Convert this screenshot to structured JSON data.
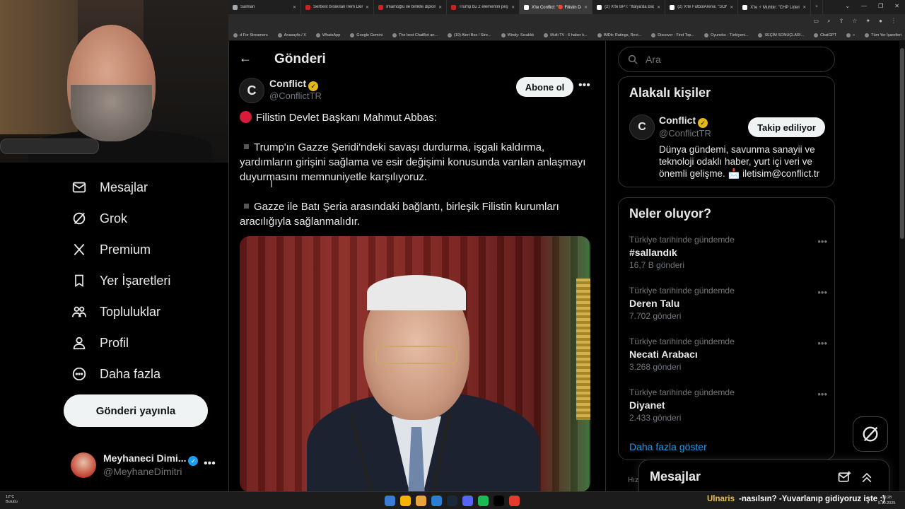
{
  "browser": {
    "tabs": [
      {
        "label": "Salman",
        "color": "#aaaaaa",
        "active": false
      },
      {
        "label": "Serbest bırakılan İrem Derici,",
        "color": "#cc2222",
        "active": false
      },
      {
        "label": "İmamoğlu ile birlikte diploma",
        "color": "#cc2222",
        "active": false
      },
      {
        "label": "Trump bu 2 elementin peşinde",
        "color": "#cc2222",
        "active": false
      },
      {
        "label": "X'te Conflict: \"🔴 Filistin Devl",
        "color": "#ffffff",
        "active": true
      },
      {
        "label": "(2) X'te BPT: \"İtalya'da Başbak",
        "color": "#ffffff",
        "active": false
      },
      {
        "label": "(2) X'te FutbolArena: \"SON D",
        "color": "#ffffff",
        "active": false
      },
      {
        "label": "X'te ⚡ Muhbir: \"CHP Lideri Ö",
        "color": "#ffffff",
        "active": false
      }
    ],
    "new_tab": "+",
    "window_controls": [
      "⌄",
      "—",
      "❐",
      "✕"
    ],
    "bookmarks": [
      "d For Streamers",
      "Anasayfa / X",
      "WhatsApp",
      "Google Gemini",
      "The best ChatBot an...",
      "(19) Alert Box / Stre...",
      "Windy: Sıcaklık",
      "Multi TV - 6 haber k...",
      "IMDb: Ratings, Revi...",
      "Discover - Find Top...",
      "Oyuneks - Türkiyeni...",
      "SEÇİM SONUÇLARI...",
      "ChatGPT",
      "»",
      "Tüm Yer İşaretleri"
    ]
  },
  "sidebar": {
    "items": [
      {
        "label": "Mesajlar",
        "icon": "mail-icon",
        "name": "sidebar-item-messages"
      },
      {
        "label": "Grok",
        "icon": "grok-icon",
        "name": "sidebar-item-grok"
      },
      {
        "label": "Premium",
        "icon": "x-logo-icon",
        "name": "sidebar-item-premium"
      },
      {
        "label": "Yer İşaretleri",
        "icon": "bookmark-icon",
        "name": "sidebar-item-bookmarks"
      },
      {
        "label": "Topluluklar",
        "icon": "communities-icon",
        "name": "sidebar-item-communities"
      },
      {
        "label": "Profil",
        "icon": "person-icon",
        "name": "sidebar-item-profile"
      },
      {
        "label": "Daha fazla",
        "icon": "more-circle-icon",
        "name": "sidebar-item-more"
      }
    ],
    "post_button": "Gönderi yayınla",
    "account": {
      "name": "Meyhaneci Dimi...",
      "handle": "@MeyhaneDimitri",
      "more": "•••"
    }
  },
  "main": {
    "back": "←",
    "title": "Gönderi",
    "author": {
      "avatar": "C",
      "name": "Conflict",
      "handle": "@ConflictTR"
    },
    "follow": "Abone ol",
    "more": "•••",
    "text": {
      "p1": "Filistin Devlet Başkanı Mahmut Abbas:",
      "p2": "Trump'ın Gazze Şeridi'ndeki savaşı durdurma, işgali kaldırma, yardımların girişini sağlama ve esir değişimi konusunda varılan anlaşmayı duyurmasını memnuniyetle karşılıyoruz.",
      "p3": "Gazze ile Batı Şeria arasındaki bağlantı, birleşik Filistin kurumları aracılığıyla sağlanmalıdır."
    }
  },
  "right": {
    "search_placeholder": "Ara",
    "related": {
      "title": "Alakalı kişiler",
      "avatar": "C",
      "name": "Conflict",
      "handle": "@ConflictTR",
      "button": "Takip ediliyor",
      "bio": "Dünya gündemi, savunma sanayii ve teknoloji odaklı haber, yurt içi veri ve önemli gelişme. 📩 iletisim@conflict.tr"
    },
    "trends": {
      "title": "Neler oluyor?",
      "items": [
        {
          "context": "Türkiye tarihinde gündemde",
          "name": "#sallandık",
          "count": "16,7 B gönderi"
        },
        {
          "context": "Türkiye tarihinde gündemde",
          "name": "Deren Talu",
          "count": "7.702 gönderi"
        },
        {
          "context": "Türkiye tarihinde gündemde",
          "name": "Necati Arabacı",
          "count": "3.268 gönderi"
        },
        {
          "context": "Türkiye tarihinde gündemde",
          "name": "Diyanet",
          "count": "2.433 gönderi"
        }
      ],
      "more": "•••",
      "show_more": "Daha fazla göster"
    },
    "messages_drawer": "Mesajlar",
    "hiz": "Hız"
  },
  "taskbar": {
    "weather_temp": "12°C",
    "weather_desc": "Bulutlu",
    "ticker_user": "Ulnaris",
    "ticker_msg": "-nasılsın? -Yuvarlanıp gidiyoruz işte :)",
    "time": "10:28",
    "date": "9.10.2025",
    "app_colors": [
      "#3a7bd5",
      "#f4b400",
      "#e8a33d",
      "#2d7dd2",
      "#1b2838",
      "#5865f2",
      "#1db954",
      "#000000",
      "#e33b2e"
    ]
  },
  "colors": {
    "accent": "#1d9bf0",
    "verified_gold": "#e2b719",
    "live_dot": "#d91a3a"
  }
}
